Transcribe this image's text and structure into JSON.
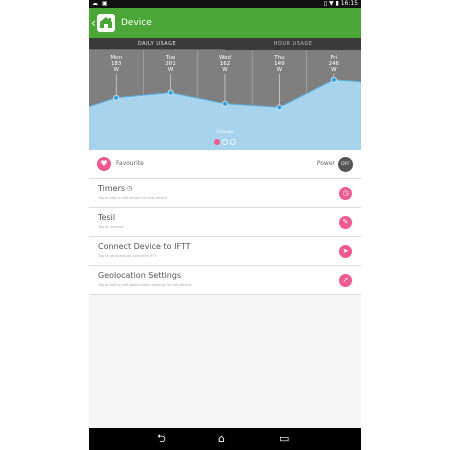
{
  "status_bar": {
    "left_icons": "☁ ▣",
    "right_icons": "▯ ▼ ▮",
    "time": "16:15"
  },
  "app_bar": {
    "title": "Device",
    "back_icon": "back-chevron-icon",
    "logo_icon": "home-logo-icon"
  },
  "tabs": [
    {
      "label": "DAILY USAGE",
      "active": true
    },
    {
      "label": "HOUR USAGE",
      "active": false
    }
  ],
  "chart_data": {
    "type": "area",
    "categories": [
      "Mon",
      "Tue",
      "Wed",
      "Thu",
      "Fri"
    ],
    "values": [
      183,
      201,
      162,
      149,
      246
    ],
    "unit": "W",
    "title": "",
    "xlabel": "",
    "ylabel": "",
    "ylim": [
      0,
      350
    ],
    "grid": true,
    "page_indicator": {
      "label": "Change",
      "count": 3,
      "active": 0
    },
    "colors": {
      "background": "#7f7f7f",
      "fill": "#a7d3ec",
      "line": "#5bb2e4",
      "point": "#3aa4de",
      "grid": "#b0b0b0",
      "dot_active": "#ef5a8f",
      "dot_inactive": "#ffffff"
    }
  },
  "favourite": {
    "label": "Favourite",
    "icon": "heart-icon",
    "power_label": "Power",
    "power_state": "OFF"
  },
  "items": [
    {
      "title": "Timers",
      "subtitle": "Tap to add or edit timers for this device",
      "icon": "clock-icon"
    },
    {
      "title": "Tesil",
      "subtitle": "Tap to rename",
      "icon": "pencil-icon"
    },
    {
      "title": "Connect Device to IFTT",
      "subtitle": "Tap to go ahead ab connecte IFTT",
      "icon": "send-icon"
    },
    {
      "title": "Geolocation Settings",
      "subtitle": "Tap to add or edit geolocation settings for this device",
      "icon": "location-arrow-icon"
    }
  ],
  "nav_bar": {
    "back": "⮌",
    "home": "⌂",
    "recents": "▭"
  },
  "colors": {
    "accent": "#4aa637",
    "pink": "#ef5a8f",
    "dark": "#3a3a3a"
  }
}
